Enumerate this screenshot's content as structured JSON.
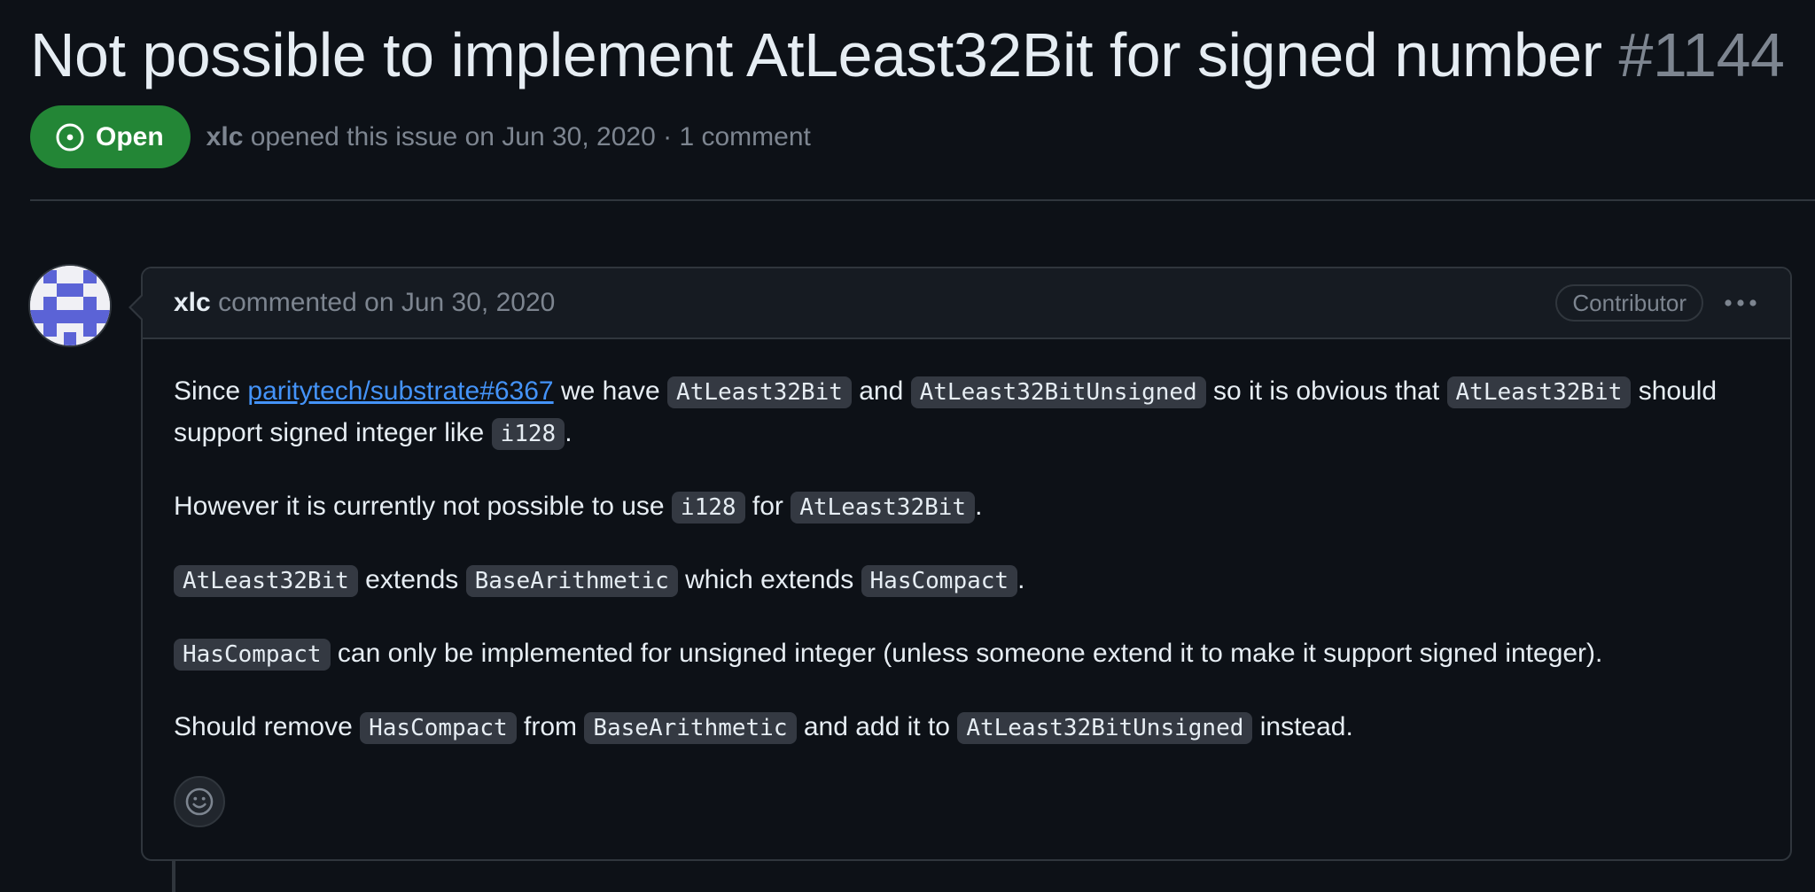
{
  "issue": {
    "title": "Not possible to implement AtLeast32Bit for signed number",
    "number": "#1144",
    "state": "Open",
    "author": "xlc",
    "opened_text": "opened this issue on Jun 30, 2020",
    "separator": "·",
    "comment_count": "1 comment"
  },
  "comment": {
    "author": "xlc",
    "timestamp_text": "commented on Jun 30, 2020",
    "role_badge": "Contributor",
    "paragraphs": {
      "p1": {
        "t1": "Since ",
        "link": "paritytech/substrate#6367",
        "t2": " we have ",
        "c1": "AtLeast32Bit",
        "t3": " and ",
        "c2": "AtLeast32BitUnsigned",
        "t4": " so it is obvious that ",
        "c3": "AtLeast32Bit",
        "t5": " should support signed integer like ",
        "c4": "i128",
        "t6": "."
      },
      "p2": {
        "t1": "However it is currently not possible to use ",
        "c1": "i128",
        "t2": " for ",
        "c2": "AtLeast32Bit",
        "t3": "."
      },
      "p3": {
        "c1": "AtLeast32Bit",
        "t1": " extends ",
        "c2": "BaseArithmetic",
        "t2": " which extends ",
        "c3": "HasCompact",
        "t3": "."
      },
      "p4": {
        "c1": "HasCompact",
        "t1": " can only be implemented for unsigned integer (unless someone extend it to make it support signed integer)."
      },
      "p5": {
        "t1": "Should remove ",
        "c1": "HasCompact",
        "t2": " from ",
        "c2": "BaseArithmetic",
        "t3": " and add it to ",
        "c3": "AtLeast32BitUnsigned",
        "t4": " instead."
      }
    }
  },
  "icons": {
    "state": "issue-opened-icon",
    "menu": "kebab-horizontal-icon",
    "reaction": "smiley-icon",
    "avatar": "identicon"
  },
  "colors": {
    "background": "#0d1117",
    "open_badge": "#238636",
    "link": "#4493f8",
    "muted_text": "#7d8590",
    "border": "#30363d",
    "code_bg": "#343942",
    "identicon": "#5b63d6"
  }
}
